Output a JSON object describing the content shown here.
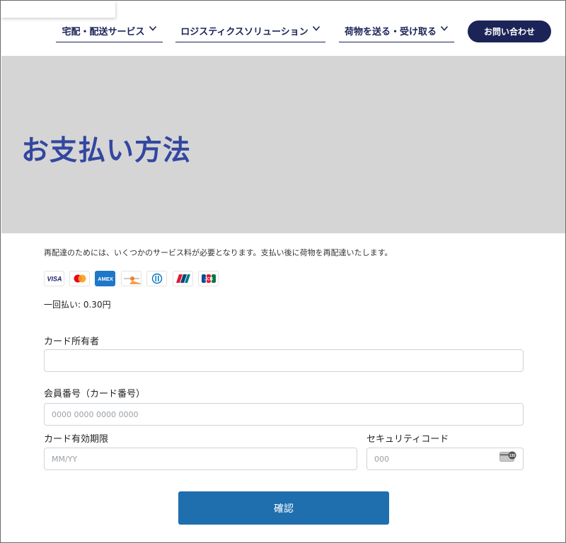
{
  "header": {
    "nav": [
      {
        "label": "宅配・配送サービス"
      },
      {
        "label": "ロジスティクスソリューション"
      },
      {
        "label": "荷物を送る・受け取る"
      }
    ],
    "contact_label": "お問い合わせ"
  },
  "hero": {
    "title": "お支払い方法"
  },
  "payment": {
    "note": "再配達のためには、いくつかのサービス料が必要となります。支払い後に荷物を再配達いたします。",
    "card_brands": [
      "VISA",
      "Mastercard",
      "AMEX",
      "Discover",
      "Diners Club",
      "UnionPay",
      "JCB"
    ],
    "price_label": "一回払い: 0.30円"
  },
  "form": {
    "holder_label": "カード所有者",
    "holder_value": "",
    "number_label": "会員番号（カード番号）",
    "number_placeholder": "0000 0000 0000 0000",
    "expiry_label": "カード有効期限",
    "expiry_placeholder": "MM/YY",
    "cvc_label": "セキュリティコード",
    "cvc_placeholder": "000",
    "cvc_icon_text": "135",
    "confirm_label": "確認"
  },
  "colors": {
    "navy": "#1b2357",
    "title_blue": "#3347a0",
    "hero_bg": "#d5d5d5",
    "button_blue": "#1f6faf"
  }
}
